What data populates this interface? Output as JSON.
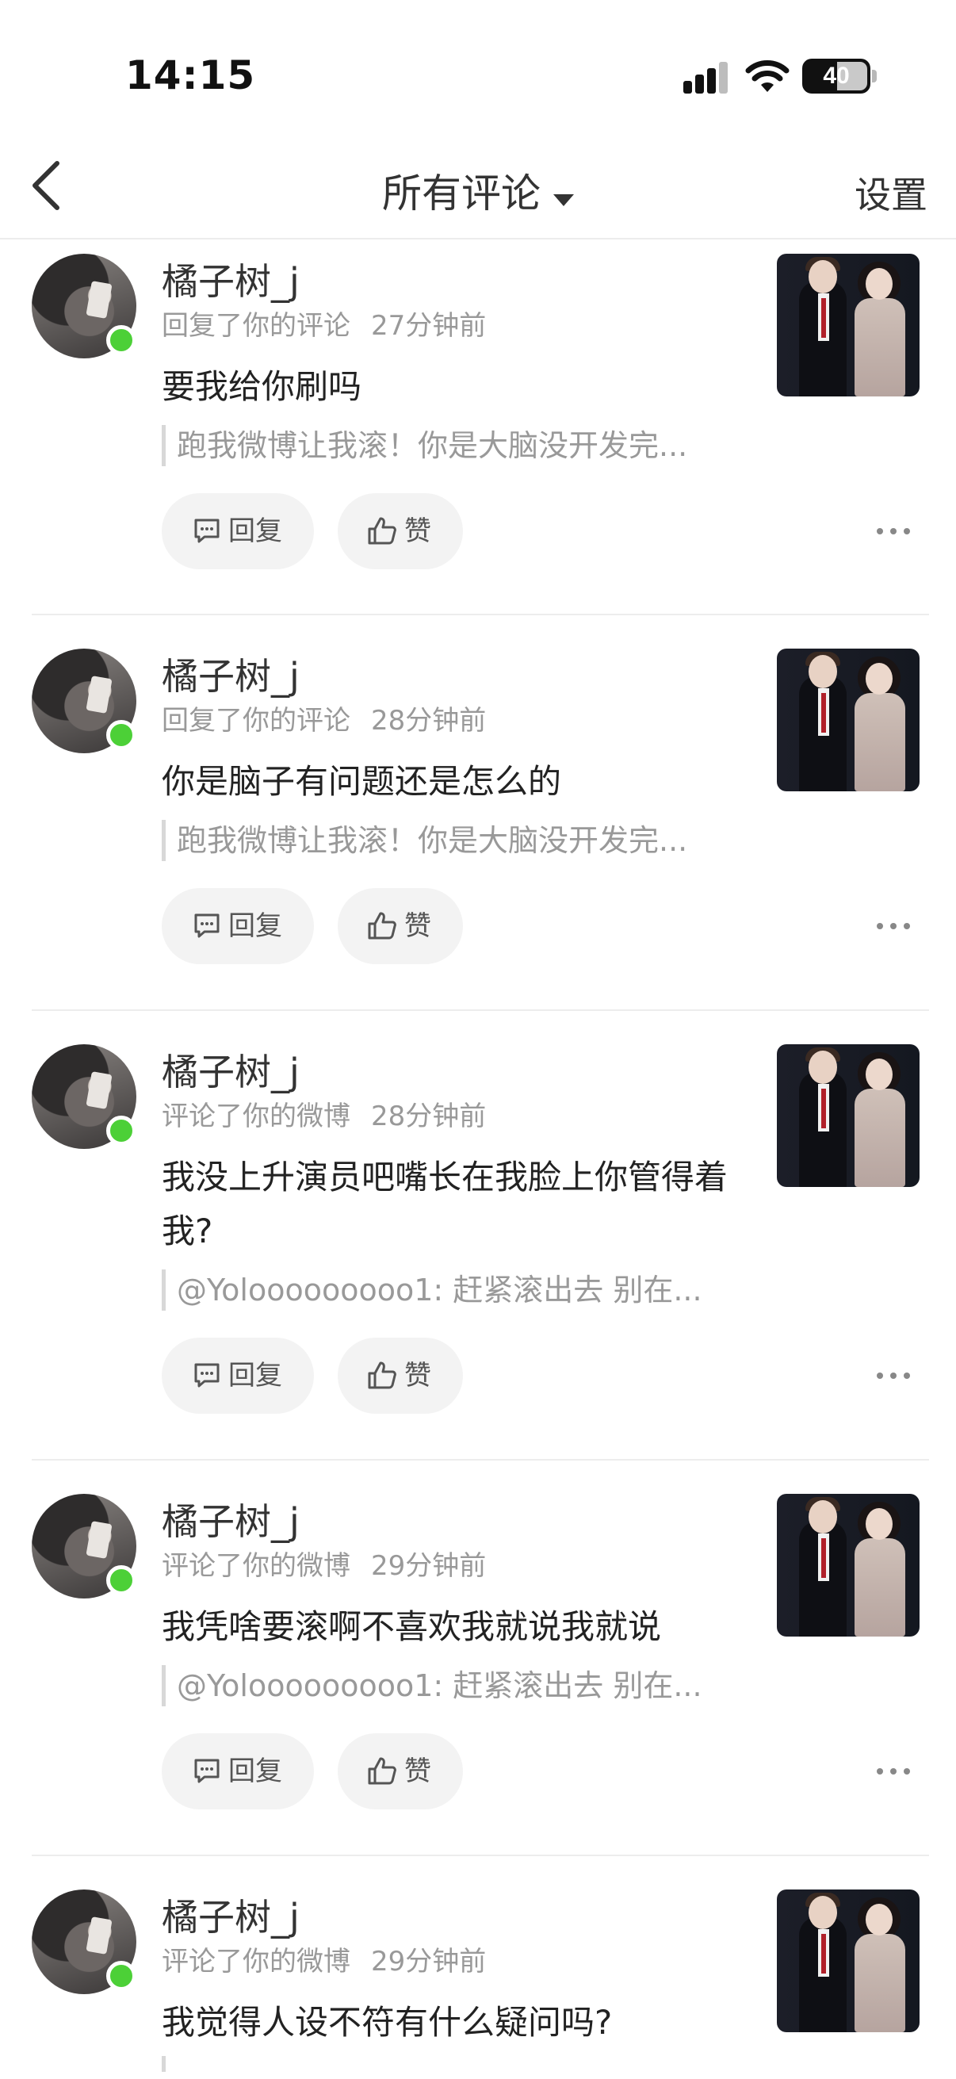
{
  "status_bar": {
    "time": "14:15",
    "battery": "40"
  },
  "nav": {
    "title": "所有评论",
    "settings": "设置"
  },
  "items": [
    {
      "username": "橘子树_j",
      "action": "回复了你的评论",
      "time_ago": "27分钟前",
      "comment": "要我给你刷吗",
      "quote": "跑我微博让我滚！你是大脑没开发完...",
      "reply_label": "回复",
      "like_label": "赞"
    },
    {
      "username": "橘子树_j",
      "action": "回复了你的评论",
      "time_ago": "28分钟前",
      "comment": "你是脑子有问题还是怎么的",
      "quote": "跑我微博让我滚！你是大脑没开发完...",
      "reply_label": "回复",
      "like_label": "赞"
    },
    {
      "username": "橘子树_j",
      "action": "评论了你的微博",
      "time_ago": "28分钟前",
      "comment": "我没上升演员吧嘴长在我脸上你管得着我?",
      "quote": "@Yolooooooooo1: 赶紧滚出去 别在...",
      "reply_label": "回复",
      "like_label": "赞"
    },
    {
      "username": "橘子树_j",
      "action": "评论了你的微博",
      "time_ago": "29分钟前",
      "comment": "我凭啥要滚啊不喜欢我就说我就说",
      "quote": "@Yolooooooooo1: 赶紧滚出去 别在...",
      "reply_label": "回复",
      "like_label": "赞"
    },
    {
      "username": "橘子树_j",
      "action": "评论了你的微博",
      "time_ago": "29分钟前",
      "comment": "我觉得人设不符有什么疑问吗?",
      "quote": "",
      "reply_label": "回复",
      "like_label": "赞"
    }
  ],
  "colors": {
    "online": "#4cd037",
    "pill_bg": "#f3f3f3",
    "divider": "#ededed"
  }
}
